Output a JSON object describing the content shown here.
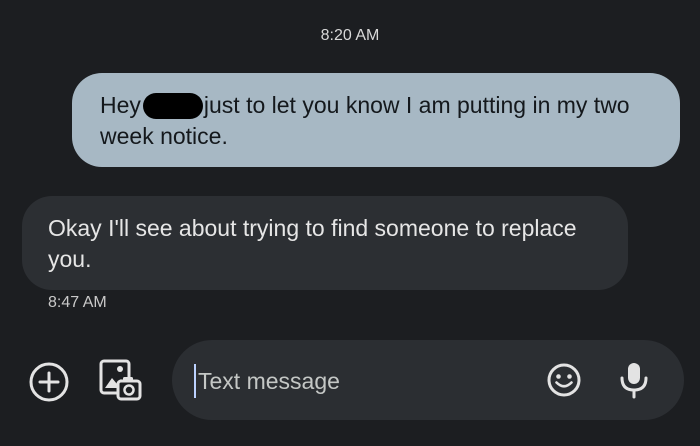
{
  "conversation": {
    "sent_time": "8:20 AM",
    "sent_message": {
      "prefix": "Hey",
      "text": "just to let you know I am putting in my two week notice."
    },
    "received_message": {
      "text": "Okay I'll see about trying to find someone to replace you."
    },
    "received_time": "8:47 AM"
  },
  "compose": {
    "placeholder": "Text message",
    "value": ""
  },
  "icons": {
    "add": "add-circle-icon",
    "gallery": "gallery-icon",
    "emoji": "emoji-icon",
    "mic": "microphone-icon"
  },
  "colors": {
    "background": "#1c1e21",
    "sent_bubble": "#a7b8c4",
    "received_bubble": "#2c2f33",
    "compose_bar": "#2b2e32"
  }
}
